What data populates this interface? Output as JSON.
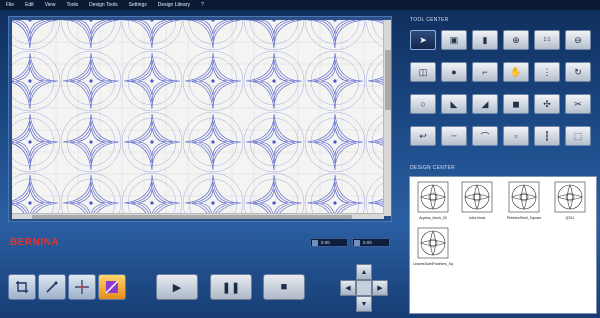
{
  "menu": {
    "items": [
      "File",
      "Edit",
      "View",
      "Tools",
      "Design Tools",
      "Settings",
      "Design Library",
      "?"
    ]
  },
  "brand": {
    "name": "BERNINA",
    "color": "#e6332a"
  },
  "readouts": [
    {
      "icon": "width-icon",
      "value": "0.00"
    },
    {
      "icon": "height-icon",
      "value": "0.00"
    }
  ],
  "tool_center": {
    "label": "TOOL CENTER",
    "rows": [
      [
        "select-arrow-icon",
        "node-edit-icon",
        "shape-icon",
        "zoom-in-icon",
        "zoom-1to1-icon",
        "zoom-out-icon"
      ],
      [
        "resize-icon",
        "point-icon",
        "crop-icon",
        "hand-pan-icon",
        "align-icon",
        "rotate-icon"
      ],
      [
        "circle-icon",
        "triangle-flag-icon",
        "triangle-icon",
        "square-icon",
        "expand-icon",
        "scissors-icon"
      ],
      [
        "undo-connect-icon",
        "stitch-line-icon",
        "path-icon",
        "group-icon",
        "ruler-icon",
        "crop-frame-icon"
      ]
    ],
    "zoom_ratio_label": "1:1"
  },
  "design_center": {
    "label": "DESIGN CENTER",
    "items": [
      {
        "name": "Aryana_block_03"
      },
      {
        "name": "Julia block"
      },
      {
        "name": "PebblesShell_Square"
      },
      {
        "name": "QS11"
      },
      {
        "name": "LeavesSwirlFeathers_Sq"
      }
    ]
  },
  "controls": {
    "left_tools": [
      "crop-icon",
      "needle-icon",
      "crosshair-icon",
      "color-icon"
    ],
    "play": "▶",
    "pause": "❚❚",
    "stop": "■"
  },
  "colors": {
    "accent": "#e6332a",
    "pattern_stroke": "#4a56c8",
    "background": "#1c4a86"
  }
}
